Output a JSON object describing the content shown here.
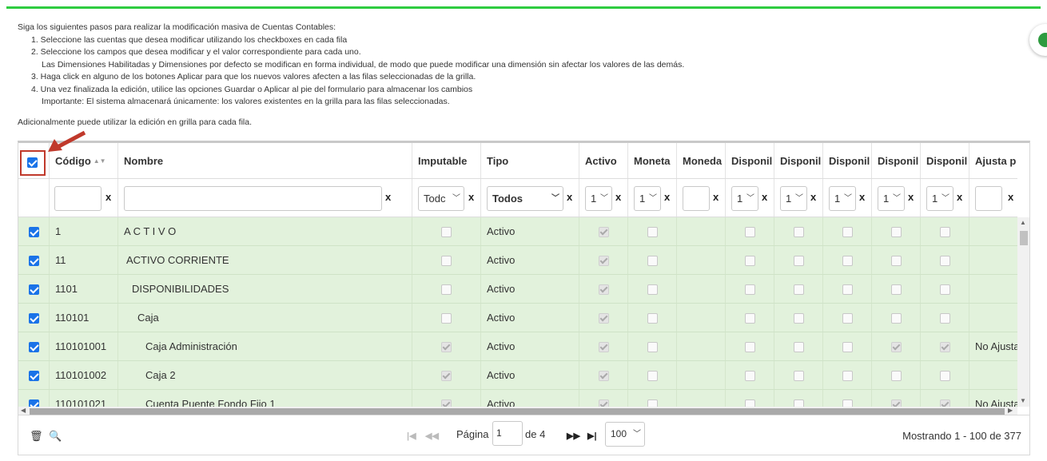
{
  "instructions": {
    "intro": "Siga los siguientes pasos para realizar la modificación masiva de Cuentas Contables:",
    "step1": "1. Seleccione las cuentas que desea modificar utilizando los checkboxes en cada fila",
    "step2": "2. Seleccione los campos que desea modificar y el valor correspondiente para cada uno.",
    "step2_note": "Las Dimensiones Habilitadas y Dimensiones por defecto se modifican en forma individual, de modo que puede modificar una dimensión sin afectar los valores de las demás.",
    "step3": "3. Haga click en alguno de los botones Aplicar para que los nuevos valores afecten a las filas seleccionadas de la grilla.",
    "step4": "4. Una vez finalizada la edición, utilice las opciones Guardar o Aplicar al pie del formulario para almacenar los cambios",
    "step4_note": "Importante: El sistema almacenará únicamente: los valores existentes en la grilla para las filas seleccionadas.",
    "additional": "Adicionalmente puede utilizar la edición en grilla para cada fila."
  },
  "grid": {
    "headers": {
      "codigo": "Código",
      "nombre": "Nombre",
      "imputable": "Imputable",
      "tipo": "Tipo",
      "activo": "Activo",
      "moneta": "Moneta",
      "moneda": "Moneda",
      "disp1": "Disponil",
      "disp2": "Disponil",
      "disp3": "Disponil",
      "disp4": "Disponil",
      "disp5": "Disponil",
      "ajusta": "Ajusta p"
    },
    "filters": {
      "clear": "x",
      "imputable_value": "Todc",
      "tipo_value": "Todos",
      "activo_value": "1",
      "moneta_value": "1",
      "disp1_value": "1",
      "disp2_value": "1",
      "disp3_value": "1",
      "disp4_value": "1",
      "disp5_value": "1"
    },
    "rows": [
      {
        "codigo": "1",
        "nombre": "A C T I V O",
        "indent": 0,
        "imputable": false,
        "tipo": "Activo",
        "activo": true,
        "disp4": false,
        "disp5": false,
        "ajusta": ""
      },
      {
        "codigo": "11",
        "nombre": "ACTIVO CORRIENTE",
        "indent": 1,
        "imputable": false,
        "tipo": "Activo",
        "activo": true,
        "disp4": false,
        "disp5": false,
        "ajusta": ""
      },
      {
        "codigo": "1101",
        "nombre": "DISPONIBILIDADES",
        "indent": 2,
        "imputable": false,
        "tipo": "Activo",
        "activo": true,
        "disp4": false,
        "disp5": false,
        "ajusta": ""
      },
      {
        "codigo": "110101",
        "nombre": "Caja",
        "indent": 3,
        "imputable": false,
        "tipo": "Activo",
        "activo": true,
        "disp4": false,
        "disp5": false,
        "ajusta": ""
      },
      {
        "codigo": "110101001",
        "nombre": "Caja Administración",
        "indent": 4,
        "imputable": true,
        "tipo": "Activo",
        "activo": true,
        "disp4": true,
        "disp5": true,
        "ajusta": "No Ajusta"
      },
      {
        "codigo": "110101002",
        "nombre": "Caja 2",
        "indent": 4,
        "imputable": true,
        "tipo": "Activo",
        "activo": true,
        "disp4": false,
        "disp5": false,
        "ajusta": ""
      },
      {
        "codigo": "110101021",
        "nombre": "Cuenta Puente Fondo Fijo 1",
        "indent": 4,
        "imputable": true,
        "tipo": "Activo",
        "activo": true,
        "disp4": true,
        "disp5": true,
        "ajusta": "No Ajusta"
      }
    ]
  },
  "footer": {
    "page_label": "Página",
    "page_value": "1",
    "of_label": "de 4",
    "page_size": "100",
    "showing": "Mostrando 1 - 100 de 377"
  }
}
